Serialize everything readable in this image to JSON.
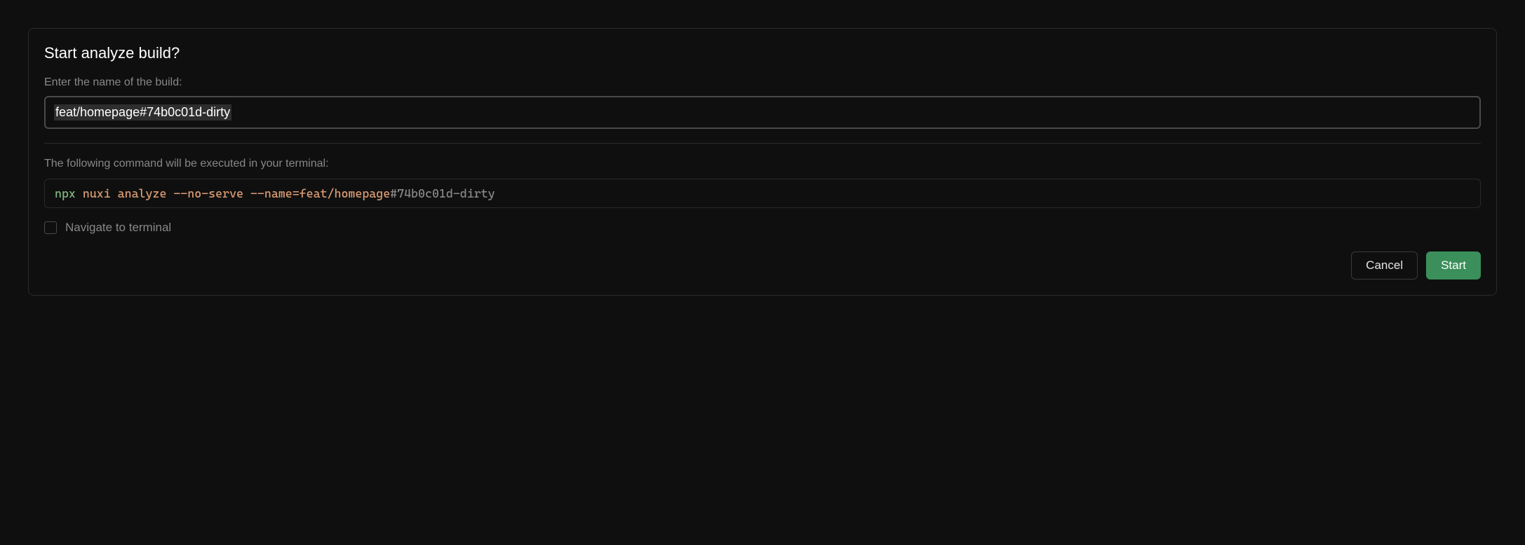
{
  "dialog": {
    "title": "Start analyze build?",
    "build_name_label": "Enter the name of the build:",
    "build_name_value": "feat/homepage#74b0c01d-dirty",
    "command_label": "The following command will be executed in your terminal:",
    "command": {
      "tokens": [
        {
          "text": "npx",
          "cls": "tok-green"
        },
        {
          "text": " ",
          "cls": ""
        },
        {
          "text": "nuxi",
          "cls": "tok-orange"
        },
        {
          "text": " ",
          "cls": ""
        },
        {
          "text": "analyze",
          "cls": "tok-orange"
        },
        {
          "text": " ",
          "cls": ""
        },
        {
          "text": "--no-serve",
          "cls": "tok-orange"
        },
        {
          "text": " ",
          "cls": ""
        },
        {
          "text": "--name=feat/homepage",
          "cls": "tok-orange"
        },
        {
          "text": "#74b0c01d-dirty",
          "cls": "tok-gray"
        }
      ]
    },
    "checkbox_label": "Navigate to terminal",
    "checkbox_checked": false,
    "cancel_label": "Cancel",
    "start_label": "Start"
  }
}
